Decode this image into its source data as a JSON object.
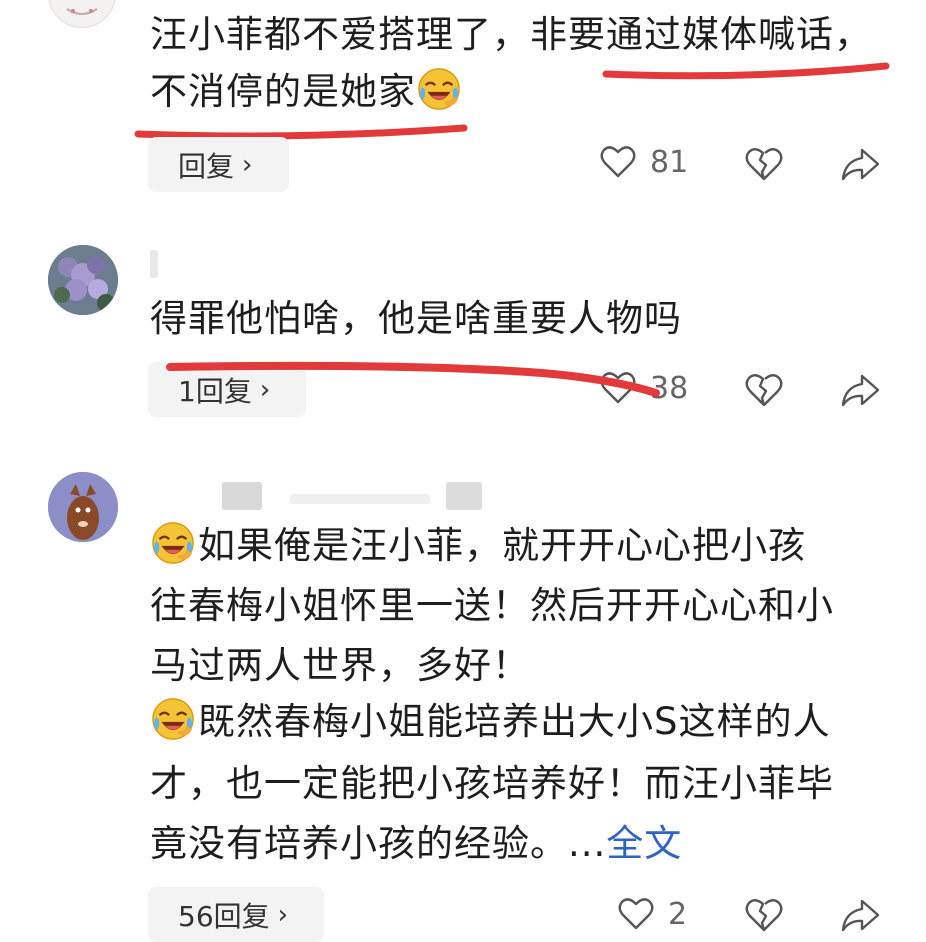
{
  "colors": {
    "accent_link": "#2f63c9",
    "underline_red": "#e23a3a",
    "text": "#1e1e1e",
    "muted": "#666666",
    "reply_bg": "#f3f3f3"
  },
  "comments": [
    {
      "text_lines": [
        "汪小菲都不爱搭理了，非要通过媒体喊话，",
        "不消停的是她家"
      ],
      "reply_label": "回复",
      "like_count": "81",
      "icons": [
        "heart-icon",
        "broken-heart-icon",
        "share-icon"
      ]
    },
    {
      "text_lines": [
        "得罪他怕啥，他是啥重要人物吗"
      ],
      "reply_label": "1回复",
      "like_count": "38",
      "icons": [
        "heart-icon",
        "broken-heart-icon",
        "share-icon"
      ]
    },
    {
      "text_lines": [
        "如果俺是汪小菲，就开开心心把小孩",
        "往春梅小姐怀里一送！然后开开心心和小",
        "马过两人世界，多好！",
        "既然春梅小姐能培养出大小S这样的人",
        "才，也一定能把小孩培养好！而汪小菲毕",
        "竟没有培养小孩的经验。..."
      ],
      "more_link": "全文",
      "reply_label": "56回复",
      "like_count": "2",
      "icons": [
        "heart-icon",
        "broken-heart-icon",
        "share-icon"
      ]
    }
  ],
  "emojis": [
    "laughing-crying-emoji"
  ]
}
